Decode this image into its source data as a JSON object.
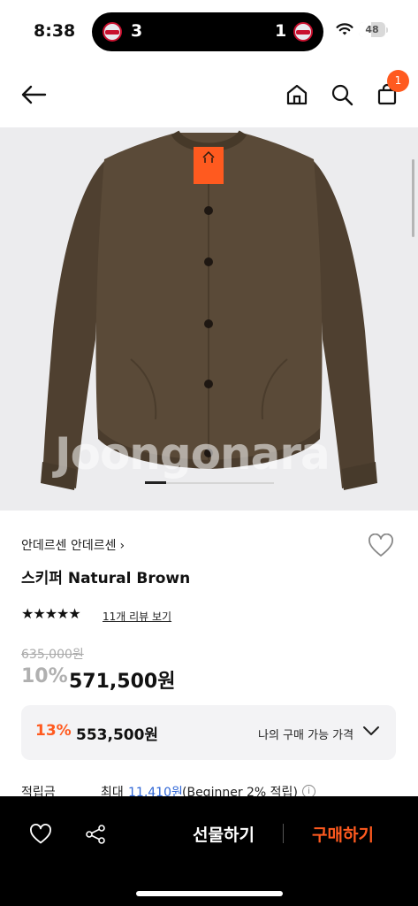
{
  "status_bar": {
    "time": "8:38",
    "score_left": "3",
    "score_right": "1",
    "battery": "48",
    "battery_level": 0.48
  },
  "nav": {
    "back_icon": "arrow-left-icon",
    "home_icon": "home-icon",
    "search_icon": "search-icon",
    "cart_icon": "shopping-bag-icon",
    "cart_count": "1"
  },
  "gallery": {
    "watermark": "Joongonara",
    "current_slide": 1
  },
  "product": {
    "brand": "안데르센 안데르센",
    "brand_chevron": "›",
    "title": "스키퍼 Natural Brown",
    "rating_stars": "★★★★★",
    "rating": 5,
    "review_link": "11개 리뷰 보기",
    "original_price": "635,000원",
    "discount": "10%",
    "sale_price": "571,500원"
  },
  "my_price": {
    "percent": "13%",
    "price": "553,500원",
    "label": "나의 구매 가능 가격"
  },
  "points": {
    "label": "적립금",
    "max_prefix": "최대",
    "value": "11,410원",
    "note": "(Beginner 2% 적립)",
    "info_glyph": "i"
  },
  "bottom_bar": {
    "gift_label": "선물하기",
    "buy_label": "구매하기"
  },
  "colors": {
    "accent": "#ff5a1f",
    "link": "#2f66d6",
    "sweater": "#5a4a38"
  }
}
